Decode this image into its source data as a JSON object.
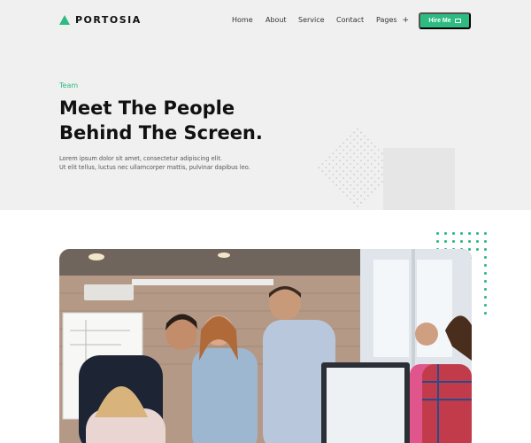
{
  "brand": {
    "name": "PORTOSIA",
    "accent": "#2dbb82"
  },
  "nav": {
    "items": [
      "Home",
      "About",
      "Service",
      "Contact",
      "Pages"
    ],
    "pages_plus": "+"
  },
  "cta": {
    "label": "Hire Me",
    "icon": "mail-icon"
  },
  "hero": {
    "eyebrow": "Team",
    "title_line1": "Meet The People",
    "title_line2": "Behind The Screen.",
    "lead_line1": "Lorem ipsum dolor sit amet, consectetur adipiscing elit.",
    "lead_line2": "Ut elit tellus, luctus nec ullamcorper mattis, pulvinar dapibus leo."
  },
  "image": {
    "subject": "team-photo"
  }
}
